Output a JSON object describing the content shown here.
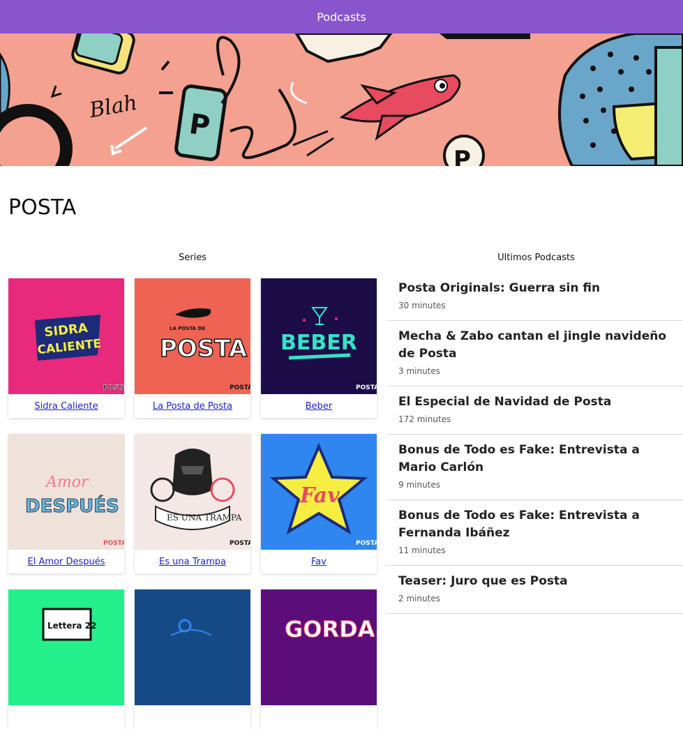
{
  "header": {
    "title": "Podcasts"
  },
  "page": {
    "title": "POSTA"
  },
  "series_section": {
    "heading": "Series"
  },
  "podcasts_section": {
    "heading": "Ultimos Podcasts"
  },
  "series": [
    {
      "label": "Sidra Caliente",
      "art_text": "SIDRA CALIENTE",
      "bg": "#e8297c"
    },
    {
      "label": "La Posta de Posta",
      "art_text": "POSTA",
      "art_sub": "LA POSTA DE",
      "bg": "#ef6354"
    },
    {
      "label": "Beber",
      "art_text": "BEBER",
      "bg": "#1c0d49"
    },
    {
      "label": "El Amor Después",
      "art_text": "DESPUÉS",
      "art_sub": "Amor",
      "bg": "#efe2da"
    },
    {
      "label": "Es una Trampa",
      "art_text": "ES UNA TRAMPA",
      "bg": "#f3e8e6"
    },
    {
      "label": "Fav",
      "art_text": "Fav",
      "bg": "#2e86ee"
    },
    {
      "label": "",
      "art_text": "Lettera 22",
      "bg": "#23f08a"
    },
    {
      "label": "",
      "art_text": "",
      "bg": "#164a86"
    },
    {
      "label": "",
      "art_text": "GORDA",
      "bg": "#5b0d7a"
    }
  ],
  "badge": "POSTA",
  "podcasts": [
    {
      "title": "Posta Originals: Guerra sin fin",
      "duration": "30 minutes"
    },
    {
      "title": "Mecha & Zabo cantan el jingle navideño de Posta",
      "duration": "3 minutes"
    },
    {
      "title": "El Especial de Navidad de Posta",
      "duration": "172 minutes"
    },
    {
      "title": "Bonus de Todo es Fake: Entrevista a Mario Carlón",
      "duration": "9 minutes"
    },
    {
      "title": "Bonus de Todo es Fake: Entrevista a Fernanda Ibáñez",
      "duration": "11 minutes"
    },
    {
      "title": "Teaser: Juro que es Posta",
      "duration": "2 minutes"
    }
  ],
  "hero": {
    "doodle_text": "Blah",
    "bg": "#f4a190"
  }
}
